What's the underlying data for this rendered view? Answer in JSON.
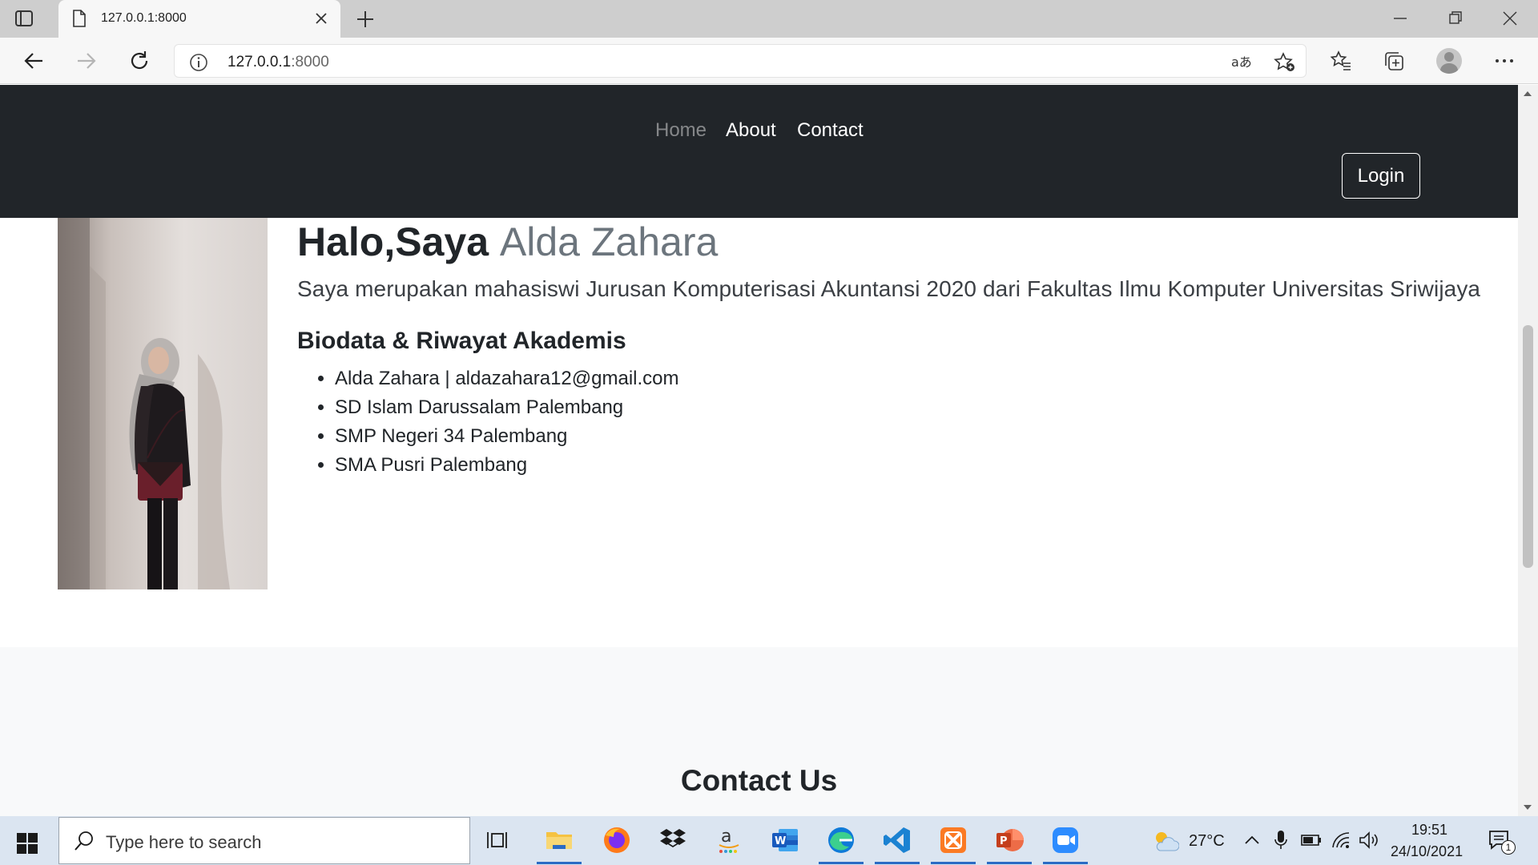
{
  "browser": {
    "tab_title": "127.0.0.1:8000",
    "address_host": "127.0.0.1",
    "address_port": ":8000"
  },
  "site": {
    "nav": {
      "home": "Home",
      "about": "About",
      "contact": "Contact",
      "login": "Login"
    },
    "hero": {
      "greeting": "Halo,Saya ",
      "name": "Alda Zahara",
      "lead": "Saya merupakan mahasiswi Jurusan Komputerisasi Akuntansi 2020 dari Fakultas Ilmu Komputer Universitas Sriwijaya"
    },
    "bio": {
      "heading": "Biodata & Riwayat Akademis",
      "items": [
        "Alda Zahara | aldazahara12@gmail.com",
        "SD Islam Darussalam Palembang",
        "SMP Negeri 34 Palembang",
        "SMA Pusri Palembang"
      ]
    },
    "contact": {
      "heading": "Contact Us"
    }
  },
  "taskbar": {
    "search_placeholder": "Type here to search",
    "temperature": "27°C",
    "time": "19:51",
    "date": "24/10/2021",
    "notification_count": "1"
  },
  "colors": {
    "navbar": "#212529",
    "muted": "#6c757d",
    "band": "#f8f9fa",
    "taskbar": "#dbe5f1"
  },
  "icons": {
    "tabbar": [
      "tab-actions-icon",
      "page-icon",
      "close-icon",
      "plus-icon",
      "minimize-icon",
      "restore-icon",
      "window-close-icon"
    ],
    "toolbar": [
      "back-icon",
      "forward-icon",
      "refresh-icon",
      "info-icon",
      "read-aloud-icon",
      "add-favorite-icon",
      "favorites-icon",
      "collections-icon",
      "profile-icon",
      "more-icon"
    ],
    "taskbar": [
      "windows-start-icon",
      "search-icon",
      "task-view-icon",
      "file-explorer-icon",
      "firefox-icon",
      "dropbox-icon",
      "amazon-icon",
      "word-icon",
      "edge-icon",
      "vscode-icon",
      "xampp-icon",
      "powerpoint-icon",
      "zoom-icon",
      "weather-icon",
      "chevron-up-icon",
      "microphone-icon",
      "battery-icon",
      "wifi-icon",
      "volume-icon",
      "notification-icon"
    ]
  }
}
